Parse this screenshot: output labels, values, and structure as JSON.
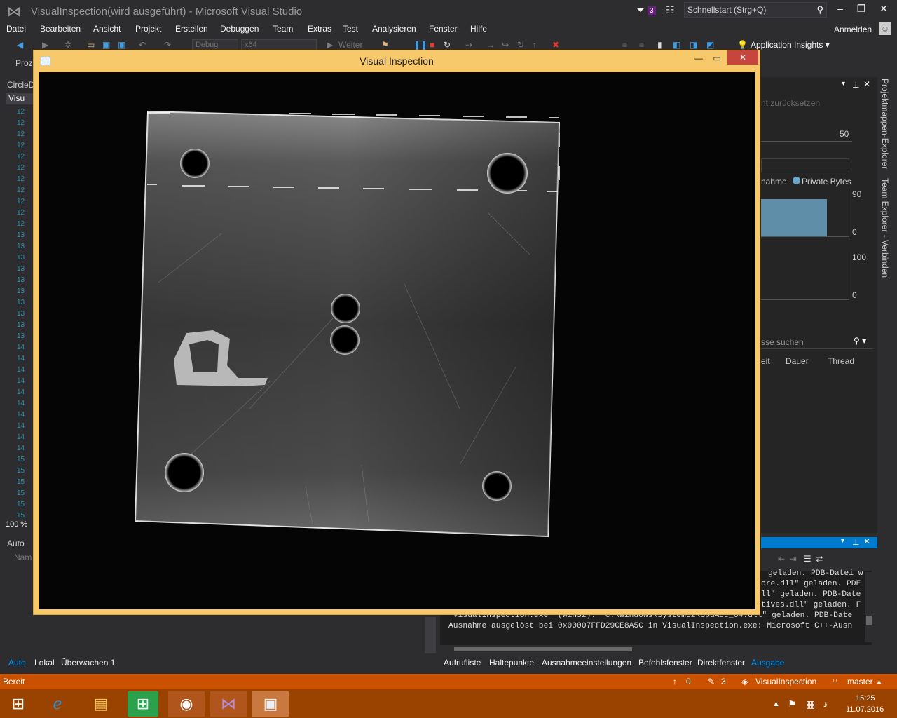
{
  "window": {
    "title": "VisualInspection(wird ausgeführt) - Microsoft Visual Studio",
    "notification_count": "3",
    "quicklaunch_placeholder": "Schnellstart (Strg+Q)",
    "sign_in": "Anmelden"
  },
  "menu": [
    "Datei",
    "Bearbeiten",
    "Ansicht",
    "Projekt",
    "Erstellen",
    "Debuggen",
    "Team",
    "Extras",
    "Test",
    "Analysieren",
    "Fenster",
    "Hilfe"
  ],
  "toolbar": {
    "config": "Debug",
    "platform": "x64",
    "continue": "Weiter",
    "insights": "Application Insights"
  },
  "ide": {
    "process_label": "Proz",
    "file_label": "CircleD",
    "editor_tab": "Visu",
    "zoom": "100 %",
    "locals_title": "Auto",
    "name_col": "Nam"
  },
  "diagnostics": {
    "reset_text": "nt zurücksetzen",
    "timeline_value": "50",
    "legend_1": "nahme",
    "legend_2": "Private Bytes",
    "mem_max": "90",
    "mem_min": "0",
    "cpu_max": "100",
    "cpu_min": "0",
    "search": "sse suchen",
    "col_time": "eit",
    "col_duration": "Dauer",
    "col_thread": "Thread",
    "private_bytes_level": 0.8
  },
  "side_tabs": [
    "Projektmappen-Explorer",
    "Team Explorer - Verbinden"
  ],
  "output": {
    "lines": [
      "geladen. PDB-Datei w",
      "ore.dll\" geladen. PDE",
      "ll\" geladen. PDB-Date",
      "tives.dll\" geladen. F"
    ],
    "wide_lines": [
      "\"VisualInspection.exe\" (Win32): \"C:\\Windows\\System32\\GpuAcc_64.dll\" geladen. PDB-Date",
      "Ausnahme ausgelöst bei 0x00007FFD29CE8A5C in VisualInspection.exe: Microsoft C++-Ausn"
    ]
  },
  "bottom_tabs_left": [
    "Auto",
    "Lokal",
    "Überwachen 1"
  ],
  "bottom_tabs_right": [
    "Aufrufliste",
    "Haltepunkte",
    "Ausnahmeeinstellungen",
    "Befehlsfenster",
    "Direktfenster",
    "Ausgabe"
  ],
  "status": {
    "ready": "Bereit",
    "up_count": "0",
    "edit_count": "3",
    "project": "VisualInspection",
    "branch": "master"
  },
  "clock": {
    "time": "15:25",
    "date": "11.07.2016"
  },
  "child_window": {
    "title": "Visual Inspection"
  },
  "gutter_lines": [
    "12",
    "12",
    "12",
    "12",
    "12",
    "12",
    "12",
    "12",
    "12",
    "12",
    "12",
    "13",
    "13",
    "13",
    "13",
    "13",
    "13",
    "13",
    "13",
    "13",
    "13",
    "14",
    "14",
    "14",
    "14",
    "14",
    "14",
    "14",
    "14",
    "14",
    "14",
    "15",
    "15",
    "15",
    "15",
    "15",
    "15"
  ]
}
